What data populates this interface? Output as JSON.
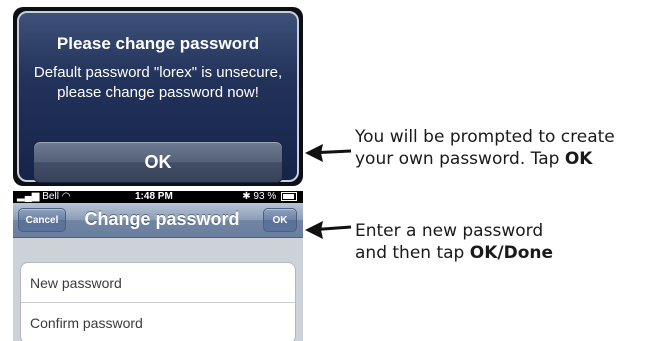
{
  "alert": {
    "title": "Please change password",
    "message": "Default password \"lorex\" is unsecure, please change password now!",
    "ok_label": "OK"
  },
  "status_bar": {
    "carrier": "Bell",
    "time": "1:48 PM",
    "battery": "93 %"
  },
  "navbar": {
    "cancel_label": "Cancel",
    "title": "Change password",
    "ok_label": "OK"
  },
  "form": {
    "new_password_placeholder": "New password",
    "confirm_password_placeholder": "Confirm password"
  },
  "callouts": {
    "first_line1": "You will be prompted to create",
    "first_line2_prefix": "your own password. Tap ",
    "first_line2_bold": "OK",
    "second_line1": "Enter a new password",
    "second_line2_prefix": "and then tap ",
    "second_line2_bold": "OK/Done"
  }
}
